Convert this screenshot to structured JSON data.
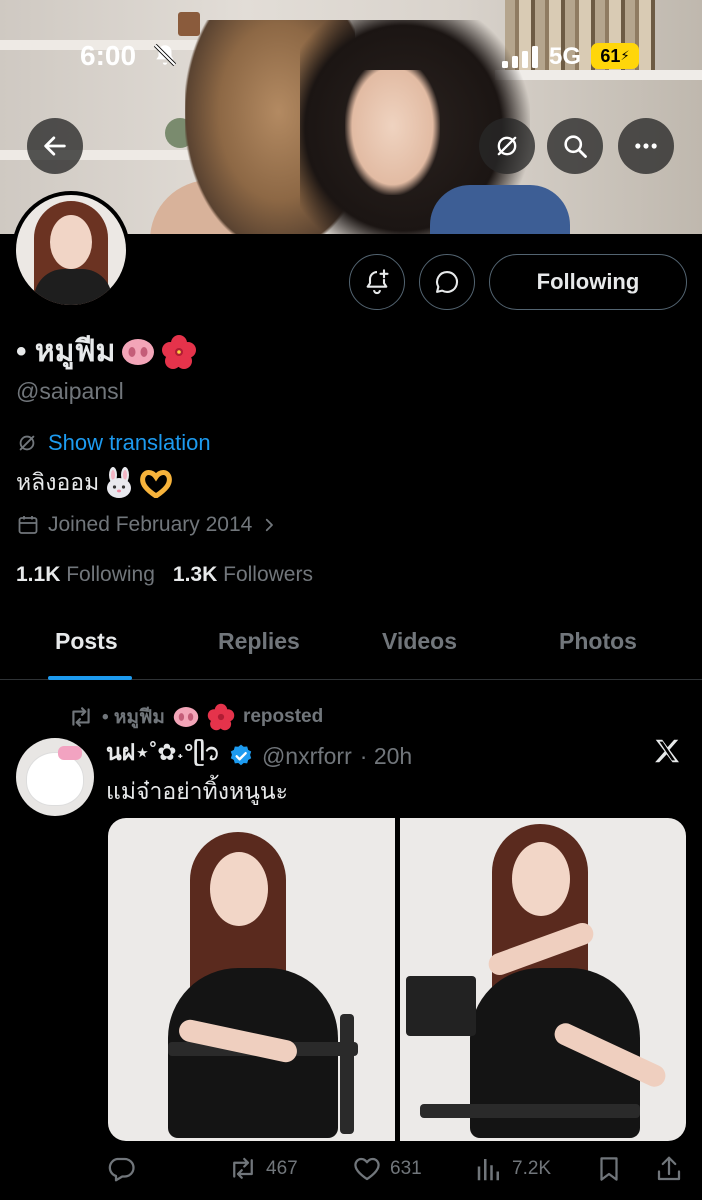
{
  "status_bar": {
    "time": "6:00",
    "network": "5G",
    "battery": "61"
  },
  "profile": {
    "name": "• หมูฟีม",
    "name_emojis": [
      "pig-nose",
      "hibiscus"
    ],
    "handle": "@saipansl",
    "show_translation": "Show translation",
    "bio": "หลิงออม",
    "bio_emojis": [
      "rabbit-face",
      "heart-hands"
    ],
    "joined": "Joined February 2014",
    "following_count": "1.1K",
    "following_label": "Following",
    "followers_count": "1.3K",
    "followers_label": "Followers",
    "follow_button": "Following"
  },
  "tabs": [
    {
      "label": "Posts",
      "active": true
    },
    {
      "label": "Replies",
      "active": false
    },
    {
      "label": "Videos",
      "active": false
    },
    {
      "label": "Photos",
      "active": false
    }
  ],
  "post": {
    "repost_by": "• หมูฟีม",
    "repost_label": "reposted",
    "author_name": "นฝ⋆˚✿˖°ᥫ᭡",
    "verified": true,
    "author_handle": "@nxrforr",
    "time": "· 20h",
    "text": "แม่จ๋าอย่าทิ้งหนูนะ",
    "replies": "",
    "reposts": "467",
    "likes": "631",
    "views": "7.2K"
  },
  "colors": {
    "accent": "#1d9bf0",
    "muted": "#71767b",
    "text": "#e7e9ea",
    "border": "#2f3336",
    "background": "#000000"
  }
}
